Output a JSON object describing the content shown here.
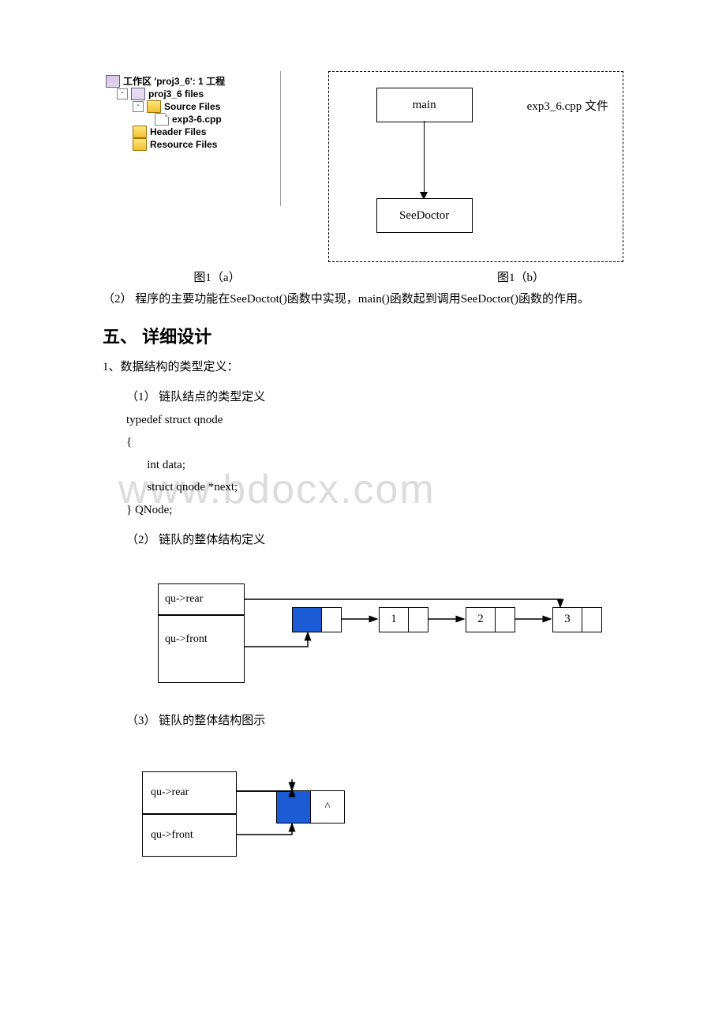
{
  "tree": {
    "workspace": "工作区 'proj3_6': 1 工程",
    "project": "proj3_6 files",
    "folders": {
      "source": "Source Files",
      "header": "Header Files",
      "resource": "Resource Files"
    },
    "file": "exp3-6.cpp"
  },
  "diagram": {
    "main": "main",
    "sub": "SeeDoctor",
    "filelabel": "exp3_6.cpp 文件"
  },
  "captions": {
    "fig1a": "图1（a）",
    "fig1b": "图1（b）"
  },
  "para2": "（2） 程序的主要功能在SeeDoctot()函数中实现，main()函数起到调用SeeDoctor()函数的作用。",
  "section5": "五、 详细设计",
  "bullet1": "1、数据结构的类型定义：",
  "sub1": "（1）  链队结点的类型定义",
  "code": {
    "l1": "typedef struct qnode",
    "l2": "{",
    "l3": "       int data;",
    "l4": "       struct qnode *next;",
    "l5": "} QNode;"
  },
  "sub2": "（2）  链队的整体结构定义",
  "sub3": "（3）  链队的整体结构图示",
  "ll": {
    "rear": "qu->rear",
    "front": "qu->front",
    "n1": "1",
    "n2": "2",
    "n3": "3",
    "nullsym": "^"
  },
  "watermark": "www.bdocx.com"
}
